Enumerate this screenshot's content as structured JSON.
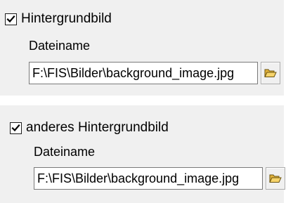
{
  "background_section": {
    "checkbox_label": "Hintergrundbild",
    "checked": true,
    "field_label": "Dateiname",
    "file_path": "F:\\FIS\\Bilder\\background_image.jpg"
  },
  "alt_background_section": {
    "checkbox_label": "anderes Hintergrundbild",
    "checked": true,
    "field_label": "Dateiname",
    "file_path": "F:\\FIS\\Bilder\\background_image.jpg"
  },
  "icons": {
    "browse": "folder-open-icon",
    "check": "checkmark-icon"
  },
  "colors": {
    "panel_background": "#f0f0f0",
    "folder_icon": "#f2c94a"
  }
}
